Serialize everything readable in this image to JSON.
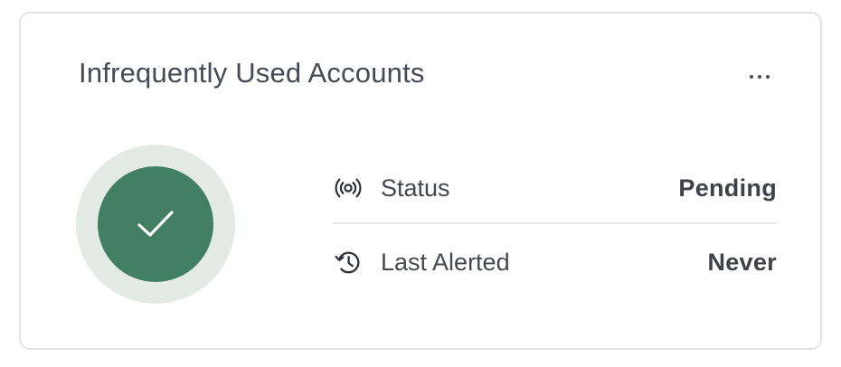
{
  "card": {
    "title": "Infrequently Used Accounts",
    "menu_icon": "more-horizontal-icon"
  },
  "indicator": {
    "icon": "checkmark-icon",
    "state": "ok",
    "ring_color": "#e4ebe7",
    "disc_color": "#437f63"
  },
  "details": [
    {
      "icon": "broadcast-icon",
      "label": "Status",
      "value": "Pending"
    },
    {
      "icon": "history-icon",
      "label": "Last Alerted",
      "value": "Never"
    }
  ]
}
